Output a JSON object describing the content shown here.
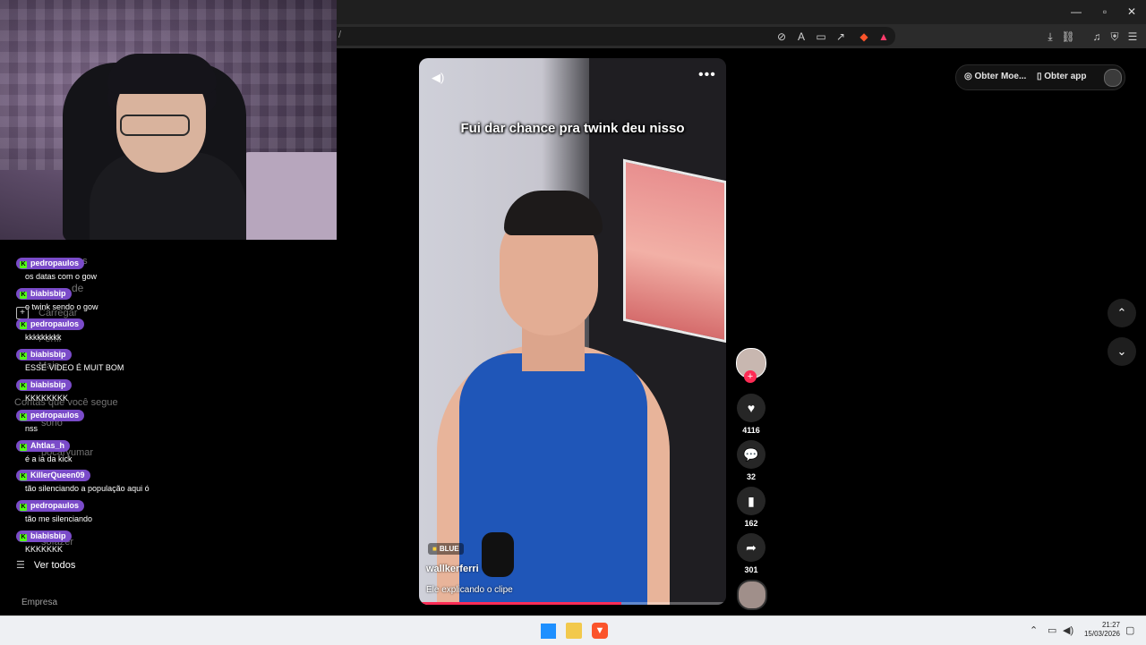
{
  "browser": {
    "window_controls": {
      "minimize": "—",
      "maximize": "▫",
      "close": "✕"
    },
    "url_fragment": "/"
  },
  "top_right": {
    "coins_label": "Obter Moe...",
    "app_label": "Obter app"
  },
  "sidebar": {
    "ghost_items": [
      "ns",
      "de",
      "Carregar",
      "Perfil",
      "Mais",
      "Contas que você segue",
      "sono",
      "pocaryumar",
      "sofazer"
    ],
    "see_all": "Ver todos",
    "company": "Empresa"
  },
  "chat": [
    {
      "user": "pedropaulos",
      "text": "os datas com o gow"
    },
    {
      "user": "biabisbip",
      "text": "o twink sendo o gow"
    },
    {
      "user": "pedropaulos",
      "text": "kkkkkkkkk"
    },
    {
      "user": "biabisbip",
      "text": "ESSE VIDEO É MUIT BOM"
    },
    {
      "user": "biabisbip",
      "text": "KKKKKKKK"
    },
    {
      "user": "pedropaulos",
      "text": "nss"
    },
    {
      "user": "Ahtlas_h",
      "text": "é a ia da kick"
    },
    {
      "user": "KillerQueen09",
      "text": "tão silenciando a população aqui ó"
    },
    {
      "user": "pedropaulos",
      "text": "tão me silenciando"
    },
    {
      "user": "biabisbip",
      "text": "KKKKKKK"
    }
  ],
  "video": {
    "caption": "Fui dar chance pra twink deu nisso",
    "badge": "BLUE",
    "author": "wallkerferri",
    "description": "Ele explicando o clipe",
    "progress": 0.66
  },
  "actions": {
    "likes": "4116",
    "comments": "32",
    "saves": "162",
    "shares": "301"
  },
  "taskbar": {
    "time": "21:27",
    "date": "15/03/2026"
  },
  "colors": {
    "accent": "#fe2c55",
    "chat_badge": "#7a4bc9",
    "kick_green": "#53fc18"
  }
}
